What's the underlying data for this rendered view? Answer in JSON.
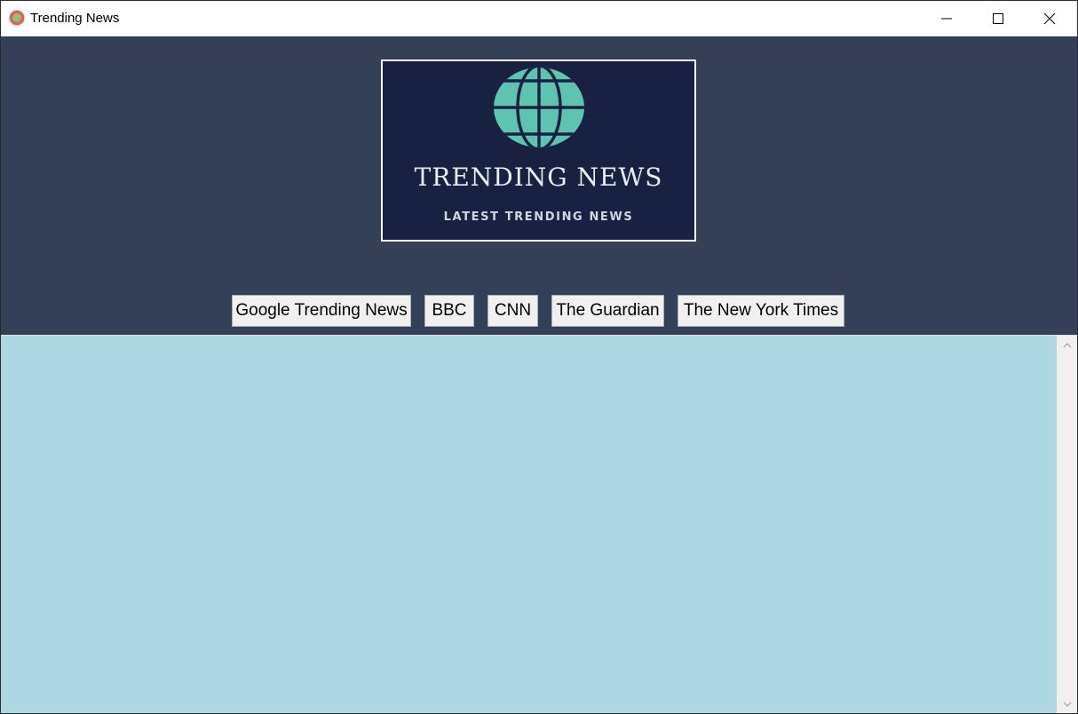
{
  "window": {
    "title": "Trending News"
  },
  "banner": {
    "title": "TRENDING NEWS",
    "subtitle": "LATEST TRENDING NEWS",
    "background_color": "#182142",
    "globe_color": "#5ec4b0"
  },
  "nav": {
    "buttons": [
      {
        "label": "Google Trending News"
      },
      {
        "label": "BBC"
      },
      {
        "label": "CNN"
      },
      {
        "label": "The Guardian"
      },
      {
        "label": "The New York Times"
      }
    ]
  },
  "colors": {
    "header_background": "#334057",
    "content_background": "#aed7e4"
  }
}
